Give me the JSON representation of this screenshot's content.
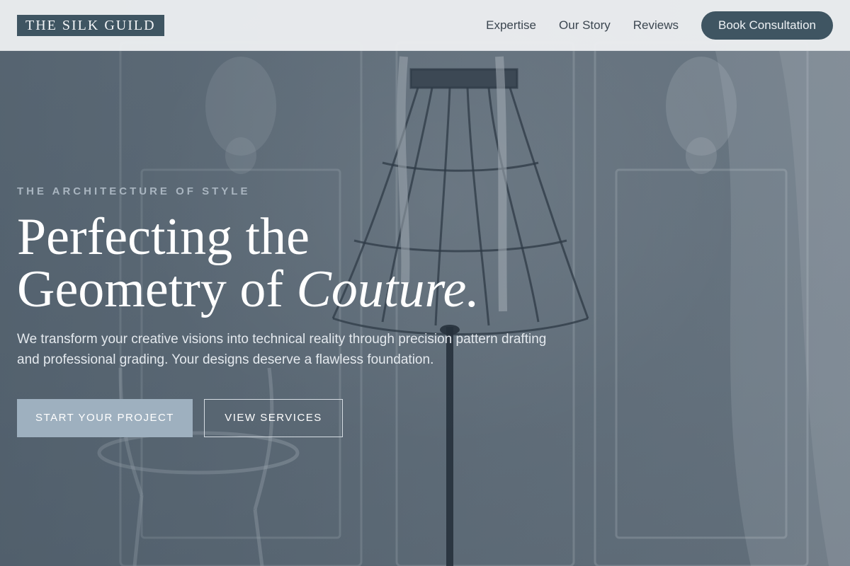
{
  "brand": {
    "logo_text": "THE SILK GUILD"
  },
  "nav": {
    "links": [
      {
        "label": "Expertise"
      },
      {
        "label": "Our Story"
      },
      {
        "label": "Reviews"
      }
    ],
    "cta_label": "Book Consultation"
  },
  "hero": {
    "eyebrow": "THE ARCHITECTURE OF STYLE",
    "headline_line1": "Perfecting the",
    "headline_line2_prefix": "Geometry of ",
    "headline_line2_emphasis": "Couture.",
    "subtext": "We transform your creative visions into technical reality through precision pattern drafting and professional grading. Your designs deserve a flawless foundation.",
    "primary_button": "START YOUR PROJECT",
    "secondary_button": "VIEW SERVICES",
    "background_image": "dress-form-icon"
  },
  "colors": {
    "header_bg": "#eceef0",
    "accent_dark": "#3f5562",
    "button_primary": "#9eb0bf",
    "eyebrow": "#a9b5c0",
    "hero_text": "#ffffff"
  }
}
